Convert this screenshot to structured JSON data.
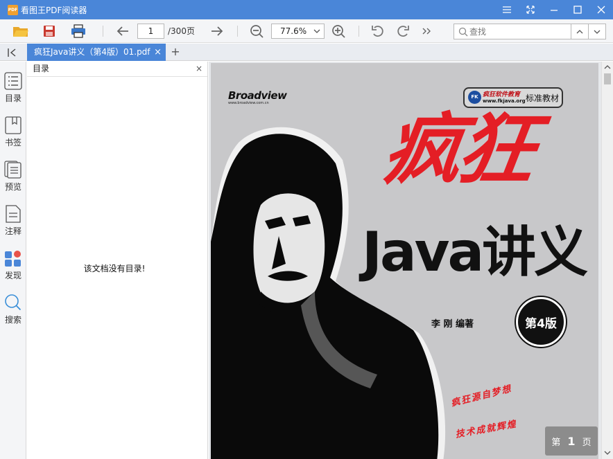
{
  "app": {
    "logo_text": "PDF",
    "title": "看图王PDF阅读器"
  },
  "toolbar": {
    "page_current": "1",
    "page_total": "/300页",
    "zoom": "77.6%",
    "search_placeholder": "查找"
  },
  "tabs": [
    {
      "label": "疯狂Java讲义（第4版）01.pdf",
      "close": "×"
    }
  ],
  "add_tab": "+",
  "sidebar": {
    "items": [
      {
        "label": "目录",
        "icon": "toc-list-icon"
      },
      {
        "label": "书签",
        "icon": "bookmark-icon"
      },
      {
        "label": "预览",
        "icon": "thumbnail-preview-icon"
      },
      {
        "label": "注释",
        "icon": "annotation-icon"
      },
      {
        "label": "发现",
        "icon": "discover-apps-icon"
      },
      {
        "label": "搜索",
        "icon": "search-icon"
      }
    ]
  },
  "outline_panel": {
    "title": "目录",
    "close": "×",
    "empty_message": "该文档没有目录!"
  },
  "cover": {
    "publisher": "Broadview",
    "publisher_url": "www.broadview.com.cn",
    "badge_brand": "疯狂软件教育",
    "badge_url": "www.fkjava.org",
    "badge_label": "标准教材",
    "badge_logo": "FK",
    "title_cn": "疯狂",
    "title_java": "Java讲义",
    "author": "李 刚  编著",
    "edition": "第4版",
    "slogan_1": "疯狂源自梦想",
    "slogan_2": "技术成就辉煌"
  },
  "page_indicator": {
    "prefix": "第",
    "number": "1",
    "suffix": "页"
  },
  "colors": {
    "accent": "#4a86d8",
    "title_red": "#e41e25"
  }
}
